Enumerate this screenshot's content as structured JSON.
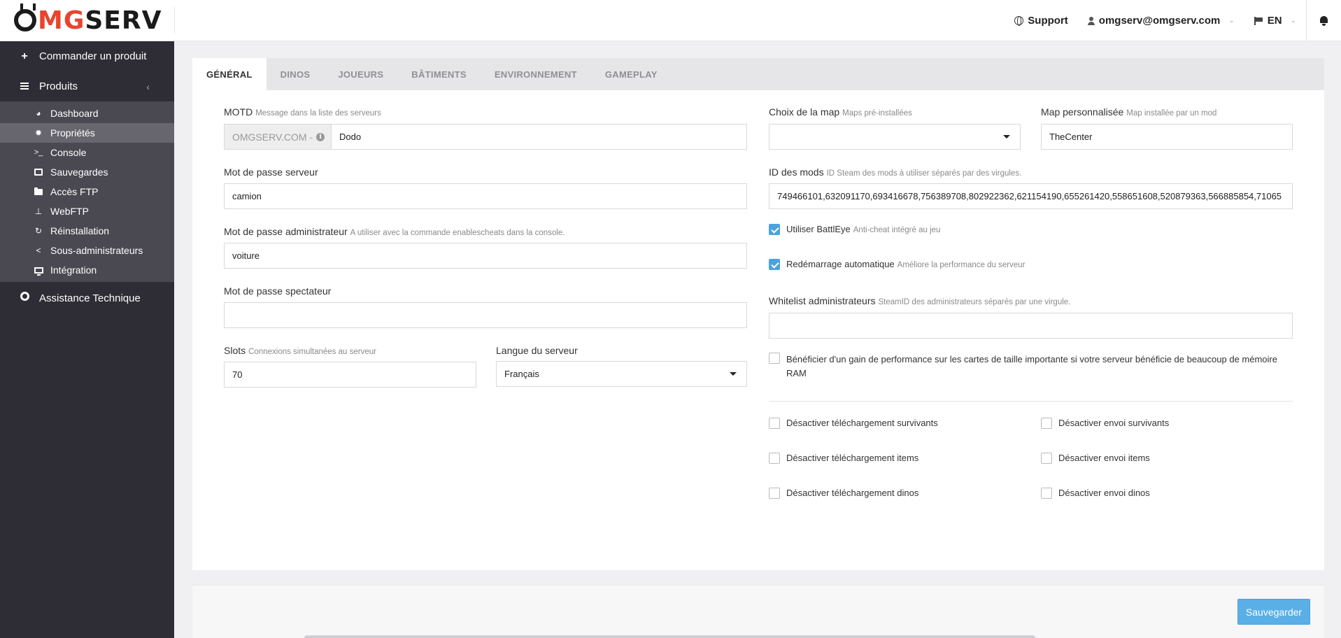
{
  "brand": {
    "logo_text_prefix": "",
    "logo_mg": "MG",
    "logo_rest": "SERV"
  },
  "topbar": {
    "support": "Support",
    "user_email": "omgserv@omgserv.com",
    "language": "EN"
  },
  "sidebar": {
    "order_product": "Commander un produit",
    "products": "Produits",
    "items": [
      {
        "label": "Dashboard",
        "icon": "dashboard-icon"
      },
      {
        "label": "Propriétés",
        "icon": "gear-icon"
      },
      {
        "label": "Console",
        "icon": "terminal-icon"
      },
      {
        "label": "Sauvegardes",
        "icon": "save-icon"
      },
      {
        "label": "Accès FTP",
        "icon": "folder-icon"
      },
      {
        "label": "WebFTP",
        "icon": "sitemap-icon"
      },
      {
        "label": "Réinstallation",
        "icon": "refresh-icon"
      },
      {
        "label": "Sous-administrateurs",
        "icon": "share-icon"
      },
      {
        "label": "Intégration",
        "icon": "monitor-icon"
      }
    ],
    "support": "Assistance Technique"
  },
  "tabs": [
    "GÉNÉRAL",
    "DINOS",
    "JOUEURS",
    "BÂTIMENTS",
    "ENVIRONNEMENT",
    "GAMEPLAY"
  ],
  "form": {
    "motd": {
      "label": "MOTD",
      "hint": "Message dans la liste des serveurs",
      "prefix": "OMGSERV.COM -",
      "value": "Dodo"
    },
    "server_password": {
      "label": "Mot de passe serveur",
      "value": "camion"
    },
    "admin_password": {
      "label": "Mot de passe administrateur",
      "hint": "A utiliser avec la commande enablescheats dans la console.",
      "value": "voiture"
    },
    "spectator_password": {
      "label": "Mot de passe spectateur",
      "value": ""
    },
    "slots": {
      "label": "Slots",
      "hint": "Connexions simultanées au serveur",
      "value": "70"
    },
    "language": {
      "label": "Langue du serveur",
      "value": "Français"
    },
    "map_choice": {
      "label": "Choix de la map",
      "hint": "Maps pré-installées",
      "value": ""
    },
    "custom_map": {
      "label": "Map personnalisée",
      "hint": "Map installée par un mod",
      "value": "TheCenter"
    },
    "mod_ids": {
      "label": "ID des mods",
      "hint": "ID Steam des mods à utiliser séparés par des virgules.",
      "value": "749466101,632091170,693416678,756389708,802922362,621154190,655261420,558651608,520879363,566885854,71065"
    },
    "battleye": {
      "label": "Utiliser BattlEye",
      "hint": "Anti-cheat intégré au jeu",
      "checked": true
    },
    "auto_restart": {
      "label": "Redémarrage automatique",
      "hint": "Améliore la performance du serveur",
      "checked": true
    },
    "admin_whitelist": {
      "label": "Whitelist administrateurs",
      "hint": "SteamID des administrateurs séparés par une virgule.",
      "value": ""
    },
    "perf_gain": {
      "label_line1": "Bénéficier d'un gain de performance sur les cartes de taille importante si votre serveur bénéficie de beaucoup de mémoire",
      "label_line2": "RAM",
      "checked": false
    },
    "disable_download_survivors": "Désactiver téléchargement survivants",
    "disable_upload_survivors": "Désactiver envoi survivants",
    "disable_download_items": "Désactiver téléchargement items",
    "disable_upload_items": "Désactiver envoi items",
    "disable_download_dinos": "Désactiver téléchargement dinos",
    "disable_upload_dinos": "Désactiver envoi dinos"
  },
  "actions": {
    "save": "Sauvegarder"
  },
  "colors": {
    "accent": "#4aa3df",
    "sidebar_bg": "#2e2d35",
    "logo_red": "#e8442e"
  }
}
